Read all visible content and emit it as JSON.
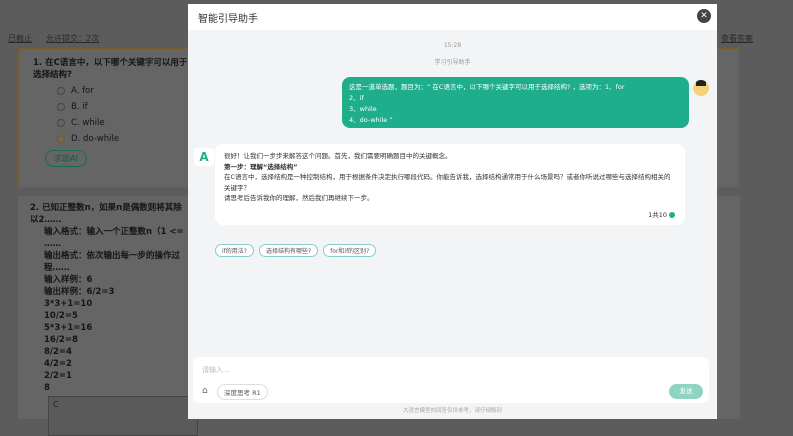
{
  "background": {
    "meta": [
      "已截止",
      "允许提交：2次"
    ],
    "right_link": "查看答案",
    "q1": {
      "title": "1. 在C语言中，以下哪个关键字可以用于选择结构?",
      "options": [
        "A. for",
        "B. if",
        "C. while",
        "D. do-while"
      ],
      "selected": 3,
      "ai_button": "求助AI"
    },
    "q2": {
      "lines": [
        "2. 已知正整数n，如果n是偶数则将其除以2……",
        "输入格式：输入一个正整数n（1 <= ……",
        "输出格式：依次输出每一步的操作过程……",
        "输入样例：6",
        "输出样例：6/2=3",
        "3*3+1=10",
        "10/2=5",
        "5*3+1=16",
        "16/2=8",
        "8/2=4",
        "4/2=2",
        "2/2=1",
        "8"
      ],
      "lang": "C"
    }
  },
  "modal": {
    "title": "智能引导助手",
    "time": "15:28",
    "subtitle": "学习引导助手",
    "user_msg": [
      "这是一道单选题，题目为：“ 在C语言中，以下哪个关键字可以用于选择结构? ，选项为：1、for",
      "2、if",
      "3、while",
      "4、do-while ”"
    ],
    "ai_msg": {
      "l1": "很好！让我们一步步来解答这个问题。首先，我们需要明确题目中的关键概念。",
      "l2": "第一步：理解“选择结构”",
      "l3": "在C语言中，选择结构是一种控制结构，用于根据条件决定执行哪段代码。你能告诉我，选择结构通常用于什么场景吗？或者你听说过哪些与选择结构相关的关键字？",
      "l4": "请思考后告诉我你的理解，然后我们再继续下一步。",
      "count": "1共10"
    },
    "suggestions": [
      "if的用法?",
      "选择结构有哪些?",
      "for和if的区别?"
    ],
    "input_placeholder": "请输入...",
    "deep_think": "深度思考 R1",
    "send": "发送",
    "footer": "大语言模型的回答仅供参考，请仔细甄别"
  },
  "colors": {
    "accent": "#1fae8c"
  }
}
